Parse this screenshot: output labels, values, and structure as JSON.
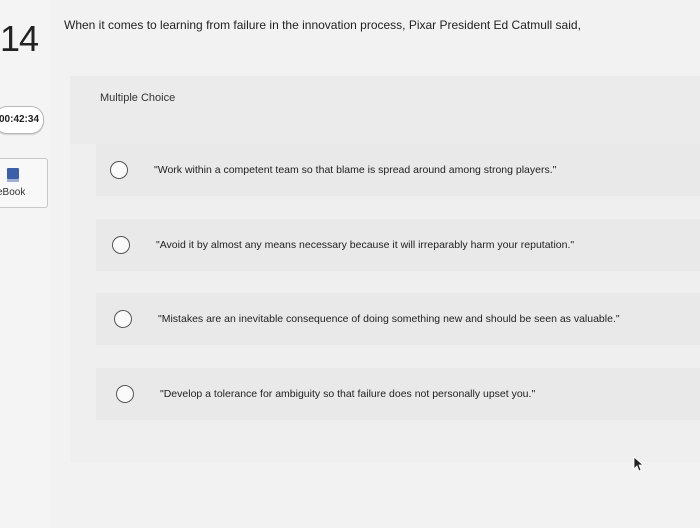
{
  "sidebar": {
    "question_number": "14",
    "timer": "00:42:34",
    "ebook_label": "eBook"
  },
  "question": {
    "text": "When it comes to learning from failure in the innovation process, Pixar President Ed Catmull said,",
    "type": "Multiple Choice"
  },
  "options": [
    "\"Work within a competent team so that blame is spread around among strong players.\"",
    "\"Avoid it by almost any means necessary because it will irreparably harm your reputation.\"",
    "\"Mistakes are an inevitable consequence of doing something new and should be seen as valuable.\"",
    "\"Develop a tolerance for ambiguity so that failure does not personally upset you.\""
  ],
  "icons": {
    "ebook": "book-icon",
    "radio": "radio-button-icon",
    "cursor": "mouse-pointer-icon"
  },
  "colors": {
    "ebook_icon": "#3b5fa8"
  }
}
